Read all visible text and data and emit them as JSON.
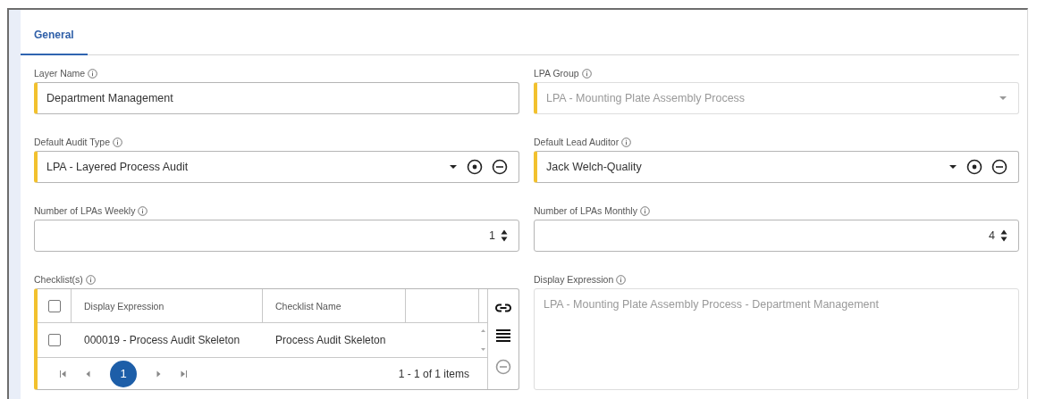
{
  "tabs": [
    {
      "label": "General",
      "selected": true
    }
  ],
  "fields": [
    {
      "kind": "text",
      "label": "Layer Name",
      "value": "Department Management",
      "required": true,
      "disabled": false
    },
    {
      "kind": "select",
      "label": "LPA Group",
      "value": "LPA - Mounting Plate Assembly Process",
      "required": true,
      "disabled": true
    },
    {
      "kind": "select_actions",
      "label": "Default Audit Type",
      "value": "LPA - Layered Process Audit",
      "required": true,
      "disabled": false
    },
    {
      "kind": "select_actions",
      "label": "Default Lead Auditor",
      "value": "Jack Welch-Quality",
      "required": true,
      "disabled": false
    },
    {
      "kind": "number",
      "label": "Number of LPAs Weekly",
      "value": "1",
      "required": false,
      "disabled": false
    },
    {
      "kind": "number",
      "label": "Number of LPAs Monthly",
      "value": "4",
      "required": false,
      "disabled": false
    },
    {
      "kind": "grid",
      "label": "Checklist(s)",
      "required": true,
      "header_checked": false,
      "columns": [
        "Display Expression",
        "Checklist Name"
      ],
      "rows": [
        {
          "checked": false,
          "cells": [
            "000019 - Process Audit Skeleton",
            "Process Audit Skeleton"
          ]
        }
      ],
      "pages": [
        {
          "label": "1",
          "selected": true
        }
      ],
      "pager_info": "1 - 1 of 1 items",
      "tools": [
        {
          "kind": "link",
          "disabled": false
        },
        {
          "kind": "list",
          "disabled": false
        },
        {
          "kind": "remove",
          "disabled": true
        }
      ]
    },
    {
      "kind": "textarea",
      "label": "Display Expression",
      "value": "LPA - Mounting Plate Assembly Process - Department Management",
      "required": false,
      "disabled": true
    }
  ]
}
